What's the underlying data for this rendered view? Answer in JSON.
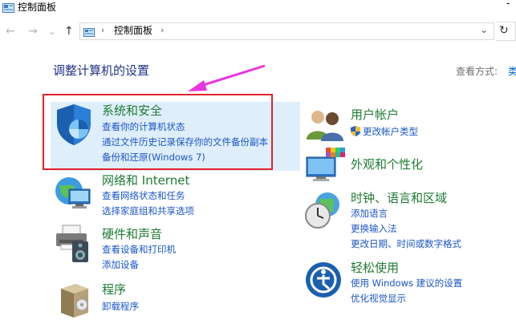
{
  "window": {
    "title": "控制面板",
    "minimize": "-"
  },
  "nav": {
    "back": "←",
    "forward": "→",
    "dropdown": "⌄",
    "up": "↑"
  },
  "address": {
    "separator_before": "›",
    "path": "控制面板",
    "separator_after": "›",
    "history_dropdown": "⌄",
    "refresh": "↻"
  },
  "page": {
    "heading": "调整计算机的设置",
    "view_by_label": "查看方式:",
    "view_by_value": "类"
  },
  "categories": {
    "system_security": {
      "title": "系统和安全",
      "links": [
        "查看你的计算机状态",
        "通过文件历史记录保存你的文件备份副本",
        "备份和还原(Windows 7)"
      ]
    },
    "network": {
      "title": "网络和 Internet",
      "links": [
        "查看网络状态和任务",
        "选择家庭组和共享选项"
      ]
    },
    "hardware": {
      "title": "硬件和声音",
      "links": [
        "查看设备和打印机",
        "添加设备"
      ]
    },
    "programs": {
      "title": "程序",
      "links": [
        "卸载程序"
      ]
    },
    "user_accounts": {
      "title": "用户帐户",
      "links": [
        "更改帐户类型"
      ]
    },
    "appearance": {
      "title": "外观和个性化",
      "links": []
    },
    "clock_region": {
      "title": "时钟、语言和区域",
      "links": [
        "添加语言",
        "更换输入法",
        "更改日期、时间或数字格式"
      ]
    },
    "ease_access": {
      "title": "轻松使用",
      "links": [
        "使用 Windows 建议的设置",
        "优化视觉显示"
      ]
    }
  },
  "annotation": {
    "arrow_color": "#e835e0",
    "box_color": "#e2222a"
  }
}
